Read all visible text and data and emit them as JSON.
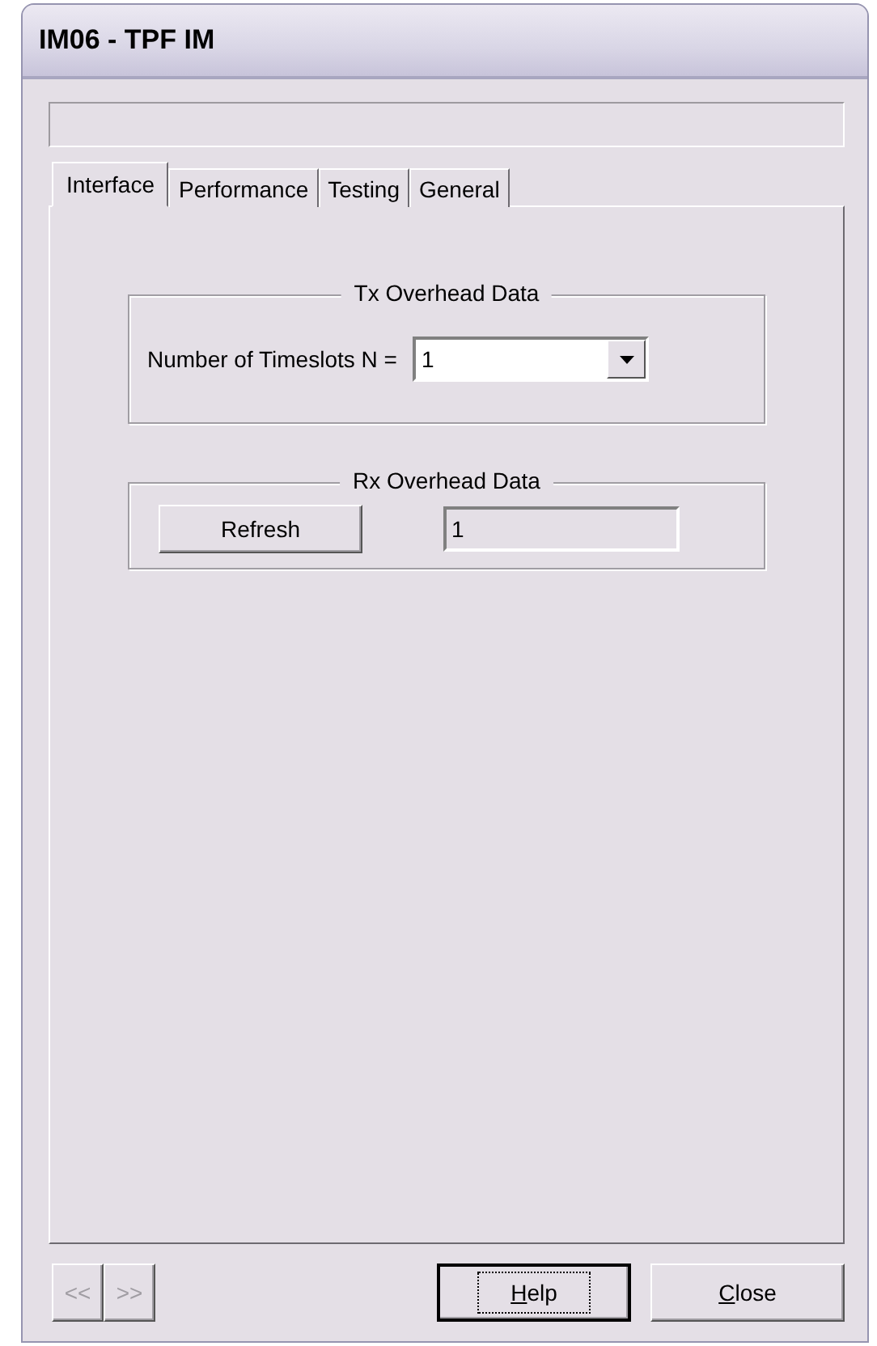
{
  "window": {
    "title": "IM06 - TPF IM"
  },
  "tabs": [
    {
      "label": "Interface",
      "selected": true
    },
    {
      "label": "Performance",
      "selected": false
    },
    {
      "label": "Testing",
      "selected": false
    },
    {
      "label": "General",
      "selected": false
    }
  ],
  "tx_group": {
    "title": "Tx Overhead Data",
    "label": "Number of Timeslots N =",
    "value": "1"
  },
  "rx_group": {
    "title": "Rx Overhead Data",
    "button": "Refresh",
    "value": "1"
  },
  "nav_buttons": [
    {
      "label": "<<",
      "disabled": true
    },
    {
      "label": ">>",
      "disabled": true
    }
  ],
  "buttons": [
    {
      "access_key": "H",
      "label_rest": "elp",
      "focused": true
    },
    {
      "access_key": "C",
      "label_rest": "lose",
      "focused": false
    }
  ]
}
